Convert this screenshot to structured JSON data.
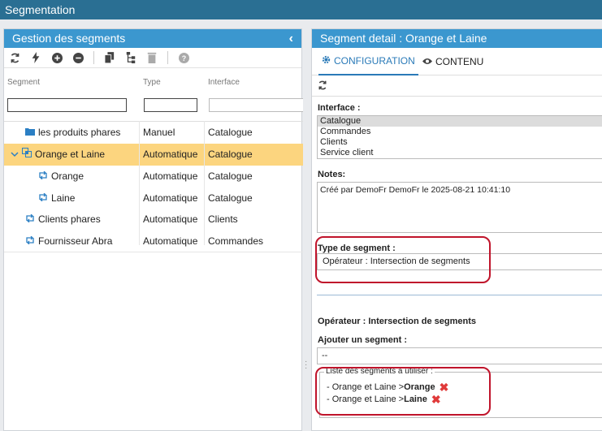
{
  "app": {
    "title": "Segmentation"
  },
  "left_panel": {
    "title": "Gestion des segments",
    "columns": {
      "segment": "Segment",
      "type": "Type",
      "interface": "Interface"
    },
    "rows": [
      {
        "name": "les produits phares",
        "type": "Manuel",
        "interface": "Catalogue",
        "icon": "folder-icon"
      },
      {
        "name": "Orange et Laine",
        "type": "Automatique",
        "interface": "Catalogue",
        "icon": "intersection-icon",
        "selected": true,
        "expanded": true
      },
      {
        "name": "Orange",
        "type": "Automatique",
        "interface": "Catalogue",
        "icon": "sync-icon"
      },
      {
        "name": "Laine",
        "type": "Automatique",
        "interface": "Catalogue",
        "icon": "sync-icon"
      },
      {
        "name": "Clients phares",
        "type": "Automatique",
        "interface": "Clients",
        "icon": "sync-icon"
      },
      {
        "name": "Fournisseur Abra",
        "type": "Automatique",
        "interface": "Commandes",
        "icon": "sync-icon"
      }
    ]
  },
  "right_panel": {
    "title": "Segment detail : Orange et Laine",
    "tabs": {
      "configuration": "CONFIGURATION",
      "contenu": "CONTENU"
    },
    "interface_label": "Interface :",
    "interface_options": [
      "Catalogue",
      "Commandes",
      "Clients",
      "Service client"
    ],
    "interface_selected": "Catalogue",
    "notes_label": "Notes:",
    "notes_value": "Créé par DemoFr DemoFr le 2025-08-21 10:41:10",
    "type_label": "Type de segment :",
    "type_value": "Opérateur : Intersection de segments",
    "operator_title": "Opérateur : Intersection de segments",
    "add_label": "Ajouter un segment :",
    "add_value": "--",
    "list_legend": "Liste des segments à utiliser :",
    "list_items": [
      {
        "prefix": "- Orange et Laine > ",
        "name": "Orange"
      },
      {
        "prefix": "- Orange et Laine > ",
        "name": "Laine"
      }
    ]
  },
  "colors": {
    "header": "#2a6f93",
    "panel_header": "#3b97cf",
    "selected_row": "#fcd57f",
    "highlight": "#c0142b",
    "tab_active": "#2a7ab8"
  }
}
